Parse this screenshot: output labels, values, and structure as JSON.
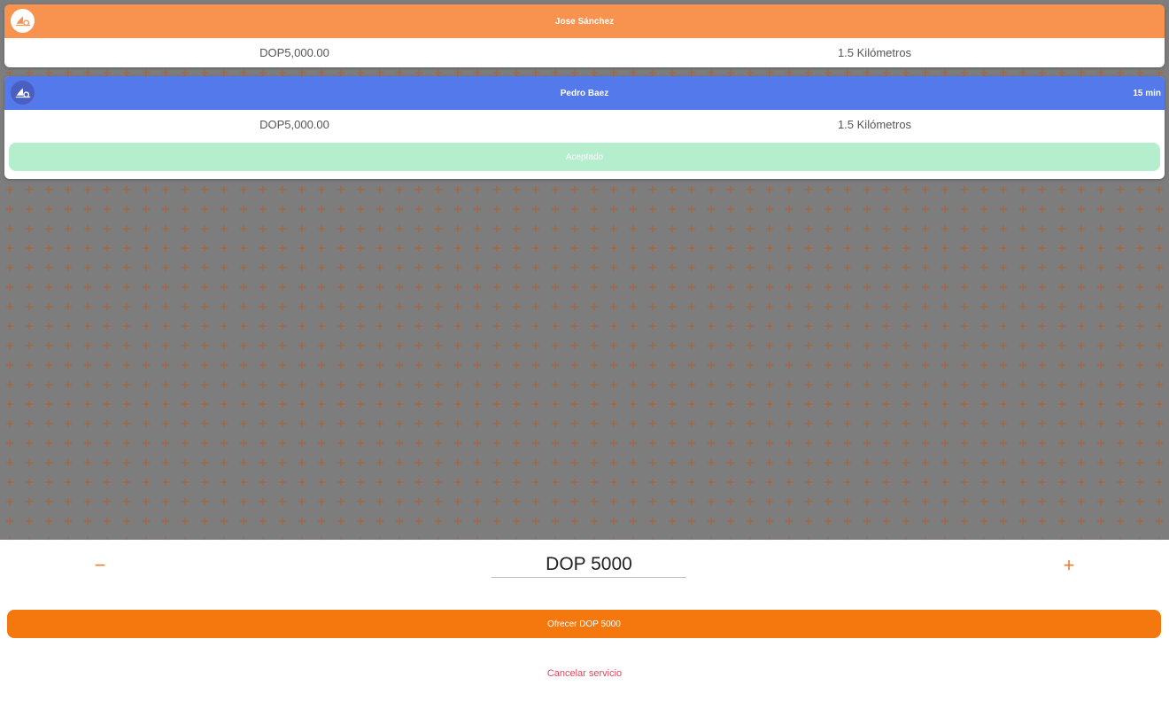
{
  "bids": [
    {
      "name": "Jose Sánchez",
      "time": "",
      "price": "DOP5,000.00",
      "distance": "1.5 Kilómetros",
      "header_color": "#f8924f"
    },
    {
      "name": "Pedro Baez",
      "time": "15 min",
      "price": "DOP5,000.00",
      "distance": "1.5 Kilómetros",
      "status": "Aceptado",
      "header_color": "#5479eb"
    }
  ],
  "offer": {
    "minus": "−",
    "plus": "+",
    "amount": "DOP 5000",
    "offer_button": "Ofrecer DOP 5000",
    "cancel": "Cancelar servicio"
  },
  "colors": {
    "accent": "#f5780f",
    "accepted": "#b5eecd",
    "cancel": "#e8435a",
    "map_bg": "#7d7d7d"
  },
  "icons": {
    "avatar": "tow-truck-logo-icon"
  }
}
